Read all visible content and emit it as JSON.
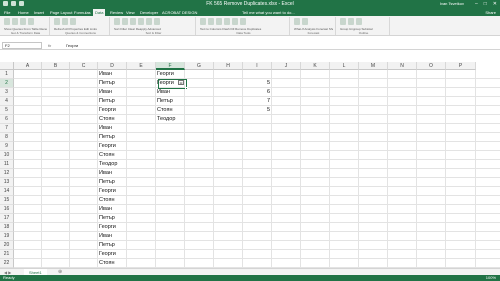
{
  "window": {
    "title": "FK 565 Remove Duplicates.xlsx - Excel",
    "user": "Ivan Tsvetkov",
    "min": "–",
    "max": "□",
    "close": "✕"
  },
  "ribbon": {
    "tabs": [
      "File",
      "Home",
      "Insert",
      "Page Layout",
      "Formulas",
      "Data",
      "Review",
      "View",
      "Developer",
      "ACROBAT",
      "DESIGN"
    ],
    "active_tab": "Data",
    "tell_me": "Tell me what you want to do...",
    "share": "Share",
    "groups": [
      {
        "name": "Get & Transform Data",
        "small": "Show Queries  From Table  Recent Sources"
      },
      {
        "name": "Queries & Connections",
        "small": "Refresh All  Properties  Edit Links"
      },
      {
        "name": "Sort & Filter",
        "small": "Sort  Filter  Clear  Reapply  Advanced"
      },
      {
        "name": "Data Tools",
        "small": "Text to Columns  Flash Fill  Remove Duplicates"
      },
      {
        "name": "Forecast",
        "small": "What-If Analysis  Forecast Sheet"
      },
      {
        "name": "Outline",
        "small": "Group  Ungroup  Subtotal"
      }
    ]
  },
  "formula_bar": {
    "name_box": "F2",
    "fx": "fx",
    "value": "Георги"
  },
  "grid": {
    "columns": [
      "A",
      "B",
      "C",
      "D",
      "E",
      "F",
      "G",
      "H",
      "I",
      "J",
      "K",
      "L",
      "M",
      "N",
      "O",
      "P"
    ],
    "selected_column": "F",
    "rows": [
      "1",
      "2",
      "3",
      "4",
      "5",
      "6",
      "7",
      "8",
      "9",
      "10",
      "11",
      "12",
      "13",
      "14",
      "15",
      "16",
      "17",
      "18",
      "19",
      "20",
      "21",
      "22"
    ],
    "selected_row": "2",
    "column_d": [
      "Иван",
      "Петър",
      "Иван",
      "Петър",
      "Георги",
      "Стоян",
      "Иван",
      "Петър",
      "Георги",
      "Стоян",
      "Теодор",
      "Иван",
      "Петър",
      "Георги",
      "Стоян",
      "Иван",
      "Петър",
      "Георги",
      "Иван",
      "Петър",
      "Георги",
      "Стоян"
    ],
    "column_f": [
      "Георги",
      "Георги",
      "Иван",
      "Петър",
      "Стоян",
      "Теодор"
    ],
    "column_i": [
      "",
      "5",
      "6",
      "7",
      "5"
    ],
    "paste_options": "Ctrl"
  },
  "sheets": {
    "nav": "◀ ▶",
    "active": "Sheet1",
    "add": "⊕"
  },
  "status": {
    "ready": "Ready",
    "zoom": "100%"
  },
  "colors": {
    "accent": "#217346",
    "grid_line": "#e3e3e3",
    "header_bg": "#f2f2f2"
  }
}
